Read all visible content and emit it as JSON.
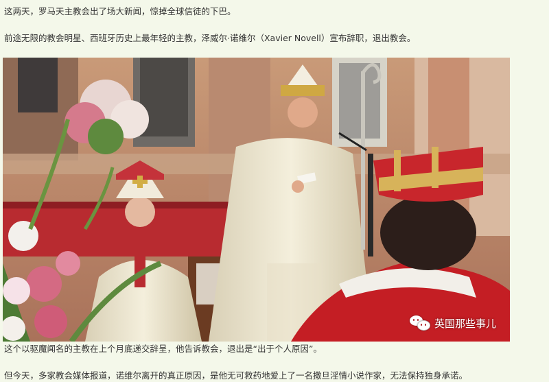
{
  "article": {
    "paragraph_1": "这两天，罗马天主教会出了场大新闻，惊掉全球信徒的下巴。",
    "paragraph_2": "前途无限的教会明星、西班牙历史上最年轻的主教，泽威尔·诺维尔（Xavier Novell）宣布辞职，退出教会。",
    "paragraph_3": "这个以驱魔闻名的主教在上个月底递交辞呈，他告诉教会，退出是“出于个人原因”。",
    "paragraph_4": "但今天，多家教会媒体报道，诺维尔离开的真正原因，是他无可救药地爱上了一名撒旦淫情小说作家，无法保持独身承诺。"
  },
  "photo": {
    "watermark_text": "英国那些事儿",
    "watermark_icon": "wechat-icon"
  },
  "colors": {
    "background": "#f4f8ea",
    "text": "#333333",
    "watermark": "#ffffff"
  }
}
